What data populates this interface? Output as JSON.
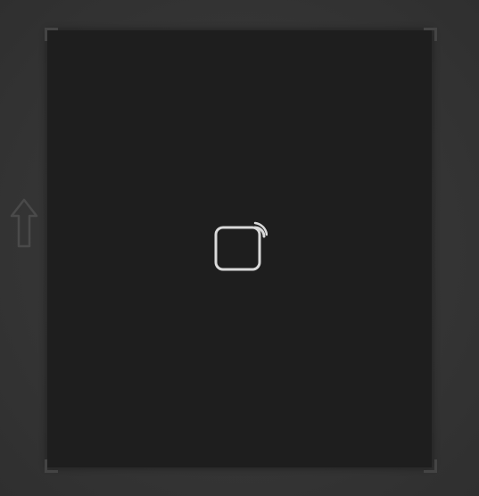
{
  "screen": {
    "background_color": "#353535"
  },
  "card": {
    "background_color": "#1e1e1e",
    "corner_color": "#444444"
  },
  "side_control": {
    "icon": "up-arrow-icon",
    "color": "#4a4a4a"
  },
  "center_icon": {
    "icon": "cast-screen-icon",
    "color": "#d9d9d9"
  }
}
